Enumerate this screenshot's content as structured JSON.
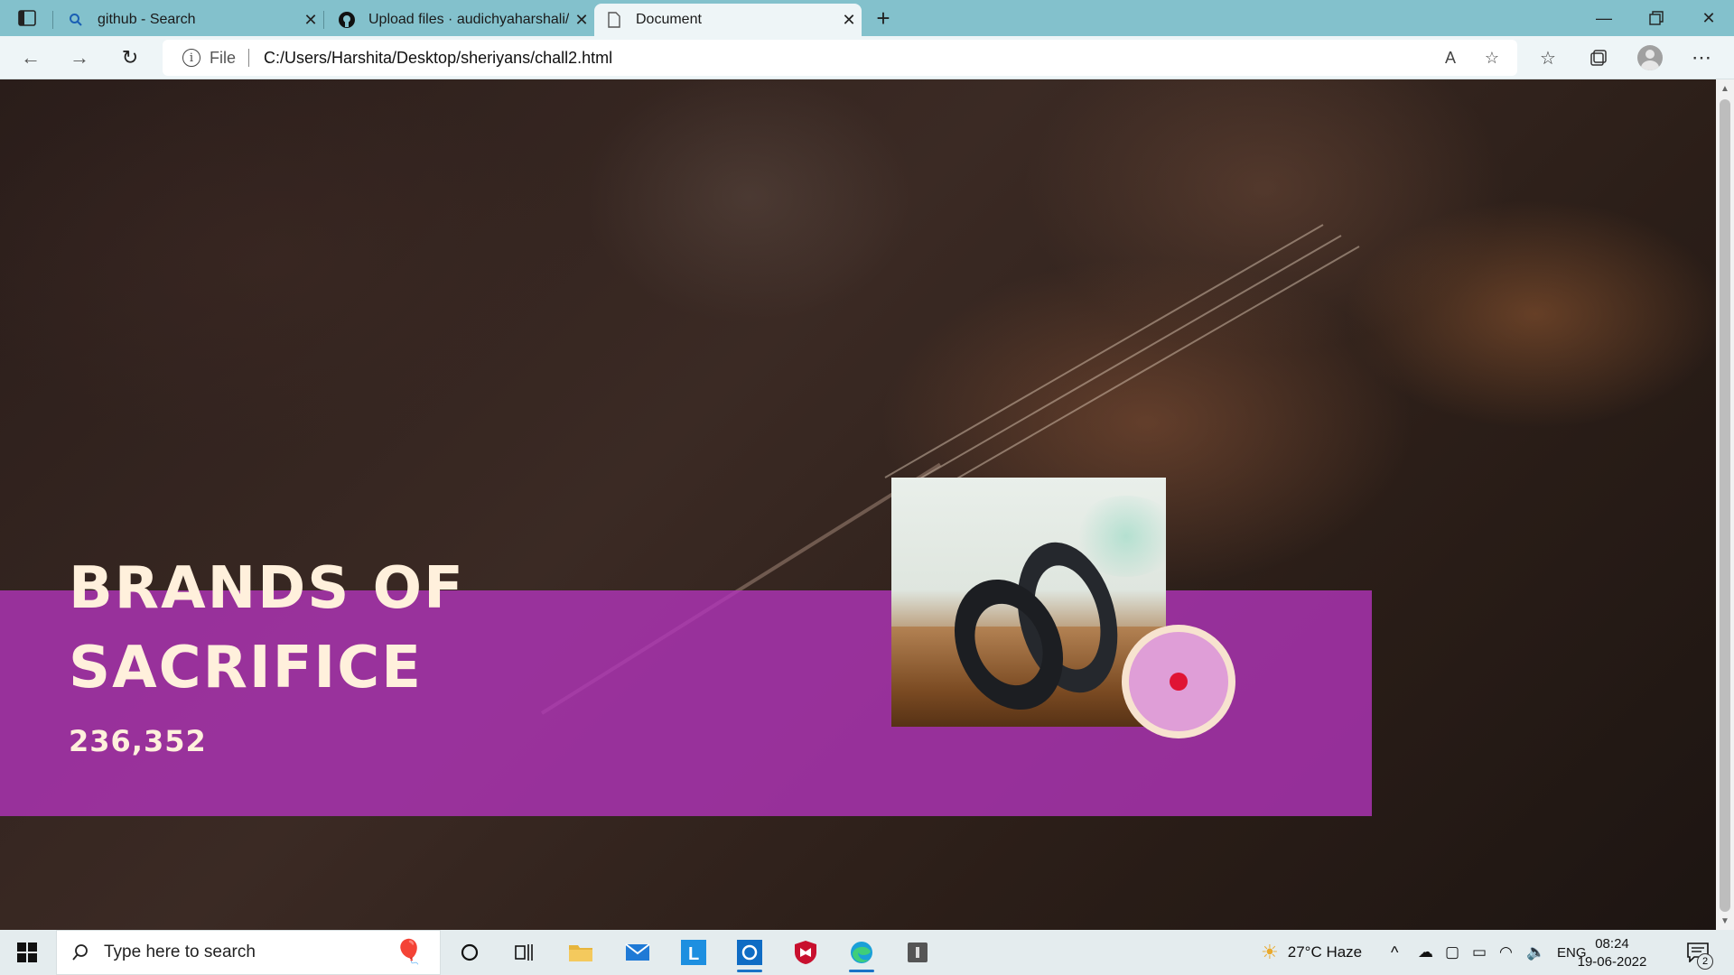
{
  "browser": {
    "tabs": [
      {
        "label": "github - Search",
        "icon": "search-icon",
        "active": false
      },
      {
        "label": "Upload files · audichyaharshali/r",
        "icon": "github-icon",
        "active": false
      },
      {
        "label": "Document",
        "icon": "document-icon",
        "active": true
      }
    ],
    "address": {
      "scheme": "File",
      "url": "C:/Users/Harshita/Desktop/sheriyans/chall2.html"
    }
  },
  "page": {
    "title_line1": "BRANDS OF",
    "title_line2": "SACRIFICE",
    "count": "236,352",
    "colors": {
      "band": "#b135ba",
      "title": "#fff0dc",
      "disc_outer": "#f7e3cf",
      "disc_inner": "#df9ed7",
      "dot": "#e01434"
    }
  },
  "taskbar": {
    "search_placeholder": "Type here to search",
    "weather": "27°C  Haze",
    "language": "ENG",
    "time": "08:24",
    "date": "19-06-2022",
    "notifications": "2"
  }
}
